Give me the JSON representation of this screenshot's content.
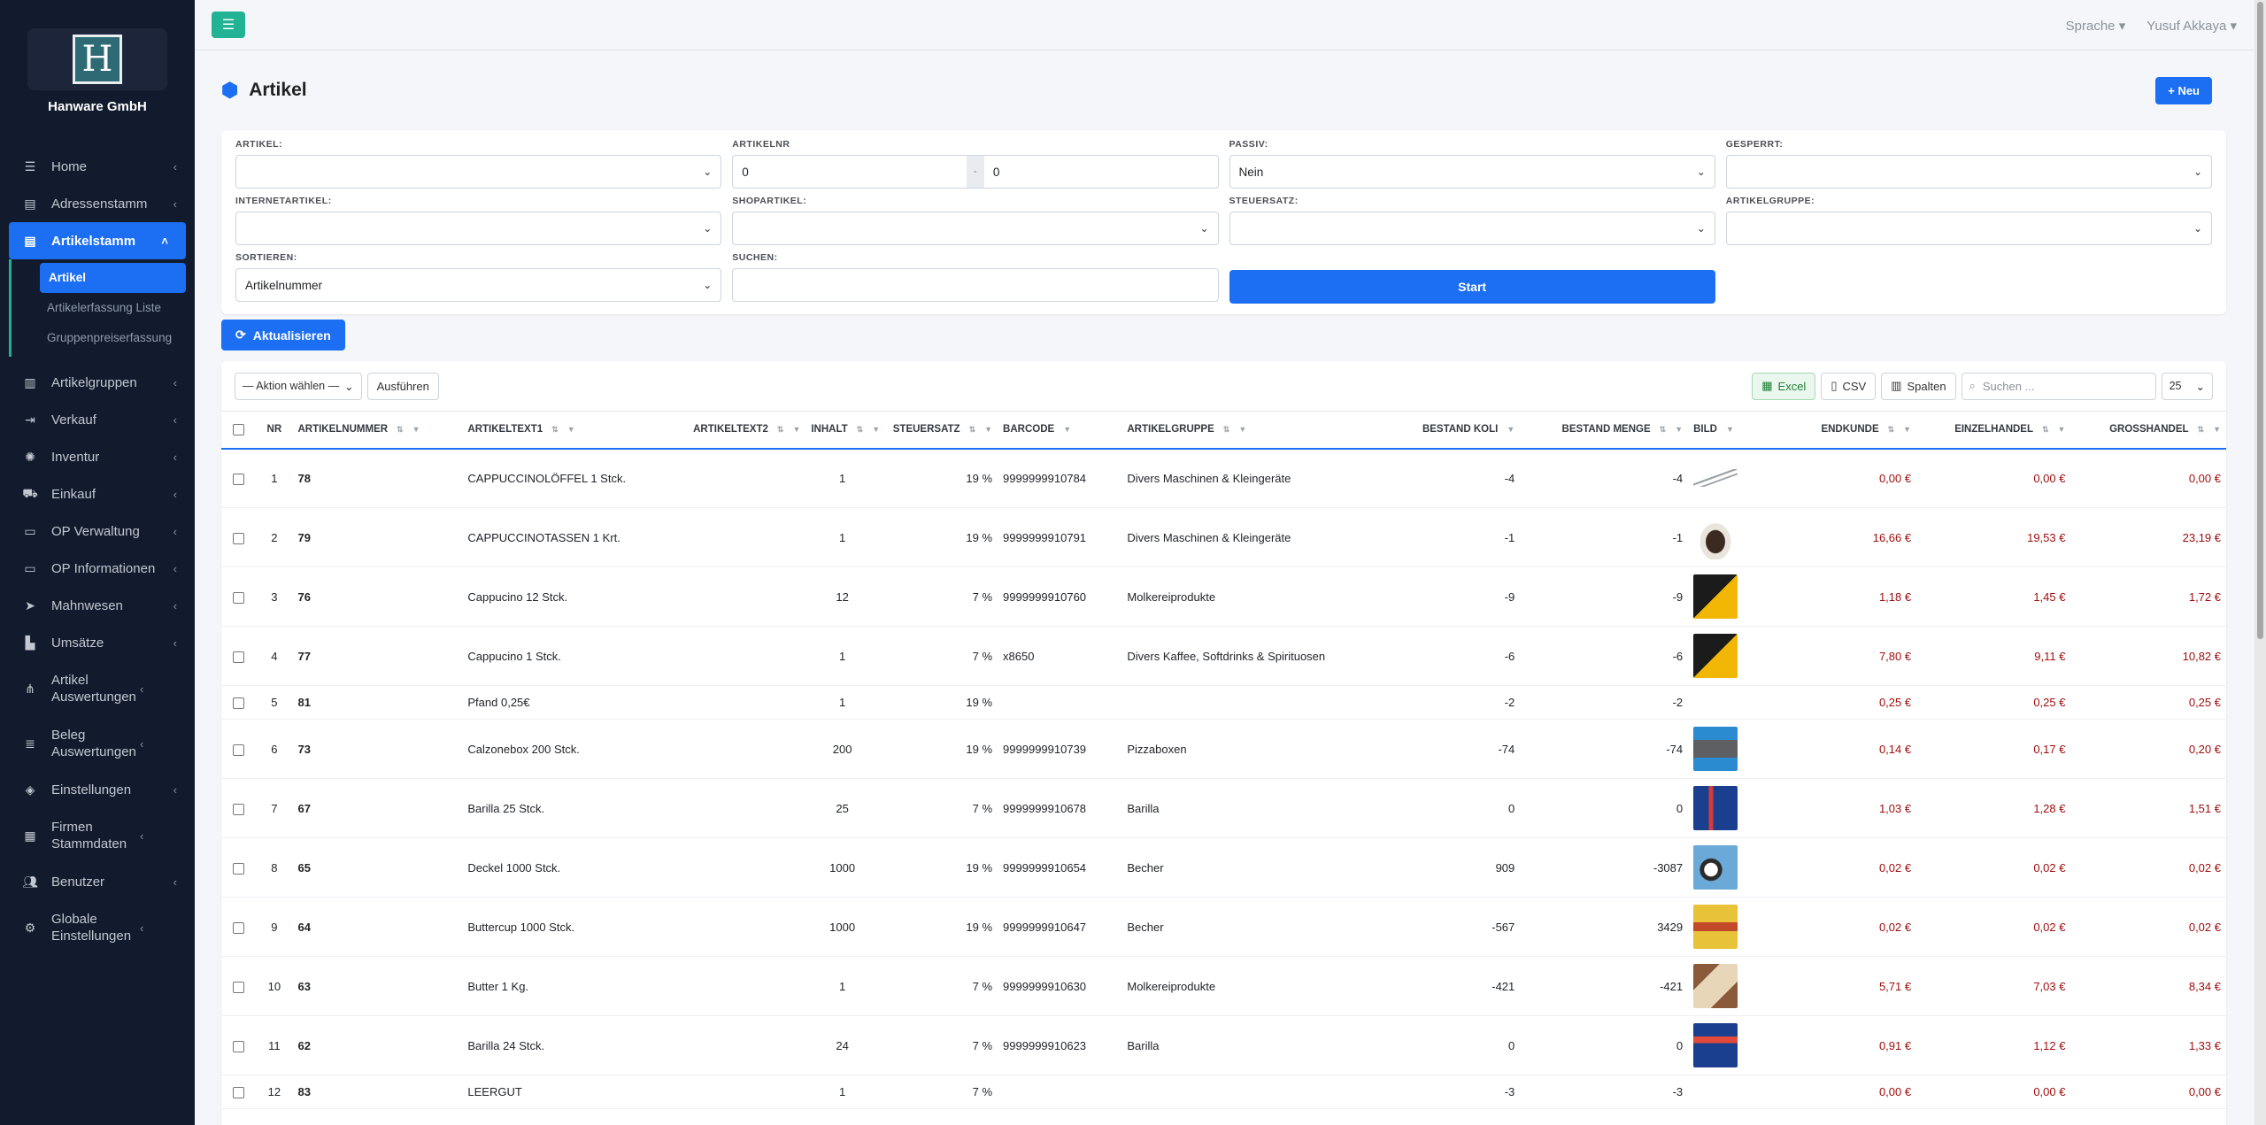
{
  "brand": {
    "name": "Hanware GmbH",
    "logo_letter": "H"
  },
  "sidebar": {
    "items": [
      {
        "label": "Home",
        "icon": "list-icon"
      },
      {
        "label": "Adressenstamm",
        "icon": "book-icon"
      },
      {
        "label": "Artikelstamm",
        "icon": "book-icon"
      },
      {
        "label": "Artikelgruppen",
        "icon": "building-icon"
      },
      {
        "label": "Verkauf",
        "icon": "sign-out-icon"
      },
      {
        "label": "Inventur",
        "icon": "spinner-icon"
      },
      {
        "label": "Einkauf",
        "icon": "cart-icon"
      },
      {
        "label": "OP Verwaltung",
        "icon": "credit-card-icon"
      },
      {
        "label": "OP Informationen",
        "icon": "credit-card-icon"
      },
      {
        "label": "Mahnwesen",
        "icon": "paper-plane-icon"
      },
      {
        "label": "Umsätze",
        "icon": "chart-icon"
      },
      {
        "label": "Artikel Auswertungen",
        "icon": "hierarchy-icon"
      },
      {
        "label": "Beleg Auswertungen",
        "icon": "receipt-icon"
      },
      {
        "label": "Einstellungen",
        "icon": "tag-icon"
      },
      {
        "label": "Firmen Stammdaten",
        "icon": "grid-icon"
      },
      {
        "label": "Benutzer",
        "icon": "users-icon"
      },
      {
        "label": "Globale Einstellungen",
        "icon": "cogs-icon"
      }
    ],
    "subitems": [
      {
        "label": "Artikel"
      },
      {
        "label": "Artikelerfassung Liste"
      },
      {
        "label": "Gruppenpreiserfassung"
      }
    ]
  },
  "topbar": {
    "language": "Sprache",
    "user": "Yusuf Akkaya"
  },
  "page": {
    "title": "Artikel",
    "new_label": "Neu"
  },
  "filters": {
    "artikel_label": "ARTIKEL:",
    "artikelnr_label": "ARTIKELNR",
    "artikelnr_from": "0",
    "artikelnr_sep": "-",
    "artikelnr_to": "0",
    "passiv_label": "PASSIV:",
    "passiv_value": "Nein",
    "gesperrt_label": "GESPERRT:",
    "internet_label": "INTERNETARTIKEL:",
    "shop_label": "SHOPARTIKEL:",
    "steuer_label": "STEUERSATZ:",
    "gruppe_label": "ARTIKELGRUPPE:",
    "sort_label": "SORTIEREN:",
    "sort_value": "Artikelnummer",
    "search_label": "SUCHEN:",
    "start_label": "Start"
  },
  "refresh_label": "Aktualisieren",
  "toolbar": {
    "action_select": "— Aktion wählen —",
    "execute": "Ausführen",
    "excel": "Excel",
    "csv": "CSV",
    "columns": "Spalten",
    "search_placeholder": "Suchen ...",
    "page_size": "25"
  },
  "table": {
    "headers": [
      "NR",
      "ARTIKELNUMMER",
      "ARTIKELTEXT1",
      "ARTIKELTEXT2",
      "INHALT",
      "STEUERSATZ",
      "BARCODE",
      "ARTIKELGRUPPE",
      "BESTAND KOLI",
      "BESTAND MENGE",
      "BILD",
      "ENDKUNDE",
      "EINZELHANDEL",
      "GROSSHANDEL"
    ],
    "rows": [
      {
        "nr": "1",
        "artnr": "78",
        "text1": "CAPPUCCINOLÖFFEL 1 Stck.",
        "text2": "",
        "inhalt": "1",
        "steuer": "19 %",
        "barcode": "9999999910784",
        "gruppe": "Divers Maschinen & Kleingeräte",
        "koli": "-4",
        "menge": "-4",
        "bild": "spoons",
        "endkunde": "0,00 €",
        "einzel": "0,00 €",
        "gross": "0,00 €"
      },
      {
        "nr": "2",
        "artnr": "79",
        "text1": "CAPPUCCINOTASSEN 1 Krt.",
        "text2": "",
        "inhalt": "1",
        "steuer": "19 %",
        "barcode": "9999999910791",
        "gruppe": "Divers Maschinen & Kleingeräte",
        "koli": "-1",
        "menge": "-1",
        "bild": "cup",
        "endkunde": "16,66 €",
        "einzel": "19,53 €",
        "gross": "23,19 €"
      },
      {
        "nr": "3",
        "artnr": "76",
        "text1": "Cappucino 12 Stck.",
        "text2": "",
        "inhalt": "12",
        "steuer": "7 %",
        "barcode": "9999999910760",
        "gruppe": "Molkereiprodukte",
        "koli": "-9",
        "menge": "-9",
        "bild": "box",
        "endkunde": "1,18 €",
        "einzel": "1,45 €",
        "gross": "1,72 €"
      },
      {
        "nr": "4",
        "artnr": "77",
        "text1": "Cappucino 1 Stck.",
        "text2": "",
        "inhalt": "1",
        "steuer": "7 %",
        "barcode": "x8650",
        "gruppe": "Divers Kaffee, Softdrinks & Spirituosen",
        "koli": "-6",
        "menge": "-6",
        "bild": "box",
        "endkunde": "7,80 €",
        "einzel": "9,11 €",
        "gross": "10,82 €"
      },
      {
        "nr": "5",
        "artnr": "81",
        "text1": "Pfand 0,25€",
        "text2": "",
        "inhalt": "1",
        "steuer": "19 %",
        "barcode": "",
        "gruppe": "",
        "koli": "-2",
        "menge": "-2",
        "bild": "",
        "endkunde": "0,25 €",
        "einzel": "0,25 €",
        "gross": "0,25 €"
      },
      {
        "nr": "6",
        "artnr": "73",
        "text1": "Calzonebox 200 Stck.",
        "text2": "",
        "inhalt": "200",
        "steuer": "19 %",
        "barcode": "9999999910739",
        "gruppe": "Pizzaboxen",
        "koli": "-74",
        "menge": "-74",
        "bild": "pizzabox",
        "endkunde": "0,14 €",
        "einzel": "0,17 €",
        "gross": "0,20 €"
      },
      {
        "nr": "7",
        "artnr": "67",
        "text1": "Barilla 25 Stck.",
        "text2": "",
        "inhalt": "25",
        "steuer": "7 %",
        "barcode": "9999999910678",
        "gruppe": "Barilla",
        "koli": "0",
        "menge": "0",
        "bild": "pasta",
        "endkunde": "1,03 €",
        "einzel": "1,28 €",
        "gross": "1,51 €"
      },
      {
        "nr": "8",
        "artnr": "65",
        "text1": "Deckel 1000 Stck.",
        "text2": "",
        "inhalt": "1000",
        "steuer": "19 %",
        "barcode": "9999999910654",
        "gruppe": "Becher",
        "koli": "909",
        "menge": "-3087",
        "bild": "lids",
        "endkunde": "0,02 €",
        "einzel": "0,02 €",
        "gross": "0,02 €"
      },
      {
        "nr": "9",
        "artnr": "64",
        "text1": "Buttercup 1000 Stck.",
        "text2": "",
        "inhalt": "1000",
        "steuer": "19 %",
        "barcode": "9999999910647",
        "gruppe": "Becher",
        "koli": "-567",
        "menge": "3429",
        "bild": "buttercup",
        "endkunde": "0,02 €",
        "einzel": "0,02 €",
        "gross": "0,02 €"
      },
      {
        "nr": "10",
        "artnr": "63",
        "text1": "Butter 1 Kg.",
        "text2": "",
        "inhalt": "1",
        "steuer": "7 %",
        "barcode": "9999999910630",
        "gruppe": "Molkereiprodukte",
        "koli": "-421",
        "menge": "-421",
        "bild": "butter",
        "endkunde": "5,71 €",
        "einzel": "7,03 €",
        "gross": "8,34 €"
      },
      {
        "nr": "11",
        "artnr": "62",
        "text1": "Barilla 24 Stck.",
        "text2": "",
        "inhalt": "24",
        "steuer": "7 %",
        "barcode": "9999999910623",
        "gruppe": "Barilla",
        "koli": "0",
        "menge": "0",
        "bild": "barilla",
        "endkunde": "0,91 €",
        "einzel": "1,12 €",
        "gross": "1,33 €"
      },
      {
        "nr": "12",
        "artnr": "83",
        "text1": "LEERGUT",
        "text2": "",
        "inhalt": "1",
        "steuer": "7 %",
        "barcode": "",
        "gruppe": "",
        "koli": "-3",
        "menge": "-3",
        "bild": "",
        "endkunde": "0,00 €",
        "einzel": "0,00 €",
        "gross": "0,00 €"
      }
    ]
  }
}
